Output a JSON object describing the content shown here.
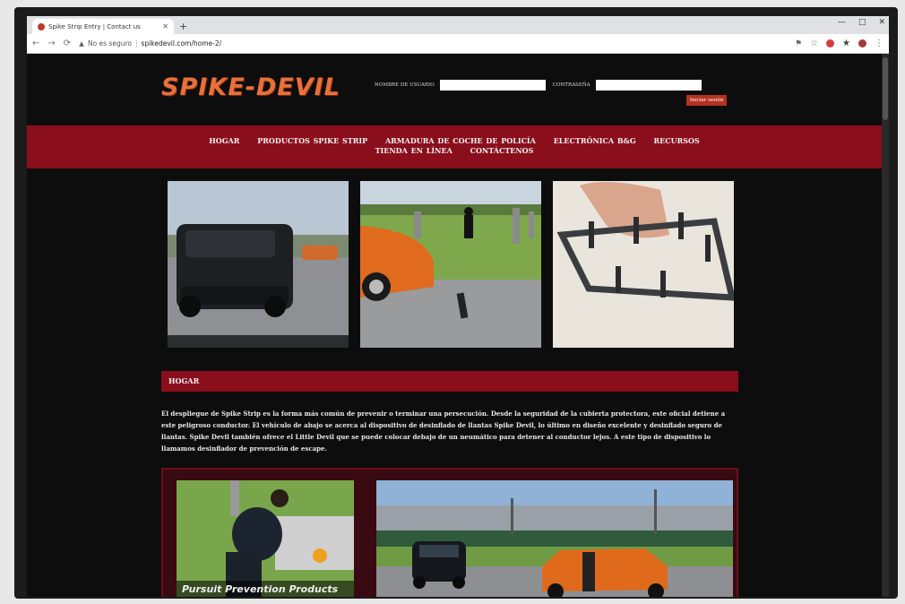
{
  "browser": {
    "tab_title": "Spike Strip Entry | Contact us",
    "url_insecure_label": "No es seguro",
    "url_host": "spikedevil.com/home-2/"
  },
  "site": {
    "logo": "SPIKE-DEVIL",
    "login": {
      "username_label": "NOMBRE DE USUARIO",
      "password_label": "CONTRASEÑA",
      "submit_label": "Iniciar sesión"
    },
    "nav": [
      "HOGAR",
      "PRODUCTOS SPIKE STRIP",
      "ARMADURA DE COCHE DE POLICÍA",
      "ELECTRÓNICA B&G",
      "RECURSOS",
      "TIENDA EN LÍNEA",
      "CONTÁCTENOS"
    ],
    "section_title": "HOGAR",
    "body_text": "El despliegue de Spike Strip es la forma más común de prevenir o terminar una persecución. Desde la seguridad de la cubierta protectora, este oficial detiene a este peligroso conductor. El vehículo de abajo se acerca al dispositivo de desinflado de llantas Spike Devil, lo último en diseño excelente y desinflado seguro de llantas. Spike Devil también ofrece el Little Devil que se puede colocar debajo de un neumático para detener al conductor lejos. A este tipo de dispositivo lo llamamos desinflador de prevención de escape.",
    "photo_caption": "Pursuit Prevention Products"
  },
  "colors": {
    "nav_red": "#8a0e1c",
    "logo_orange": "#e8703a",
    "background": "#0d0d0d"
  }
}
